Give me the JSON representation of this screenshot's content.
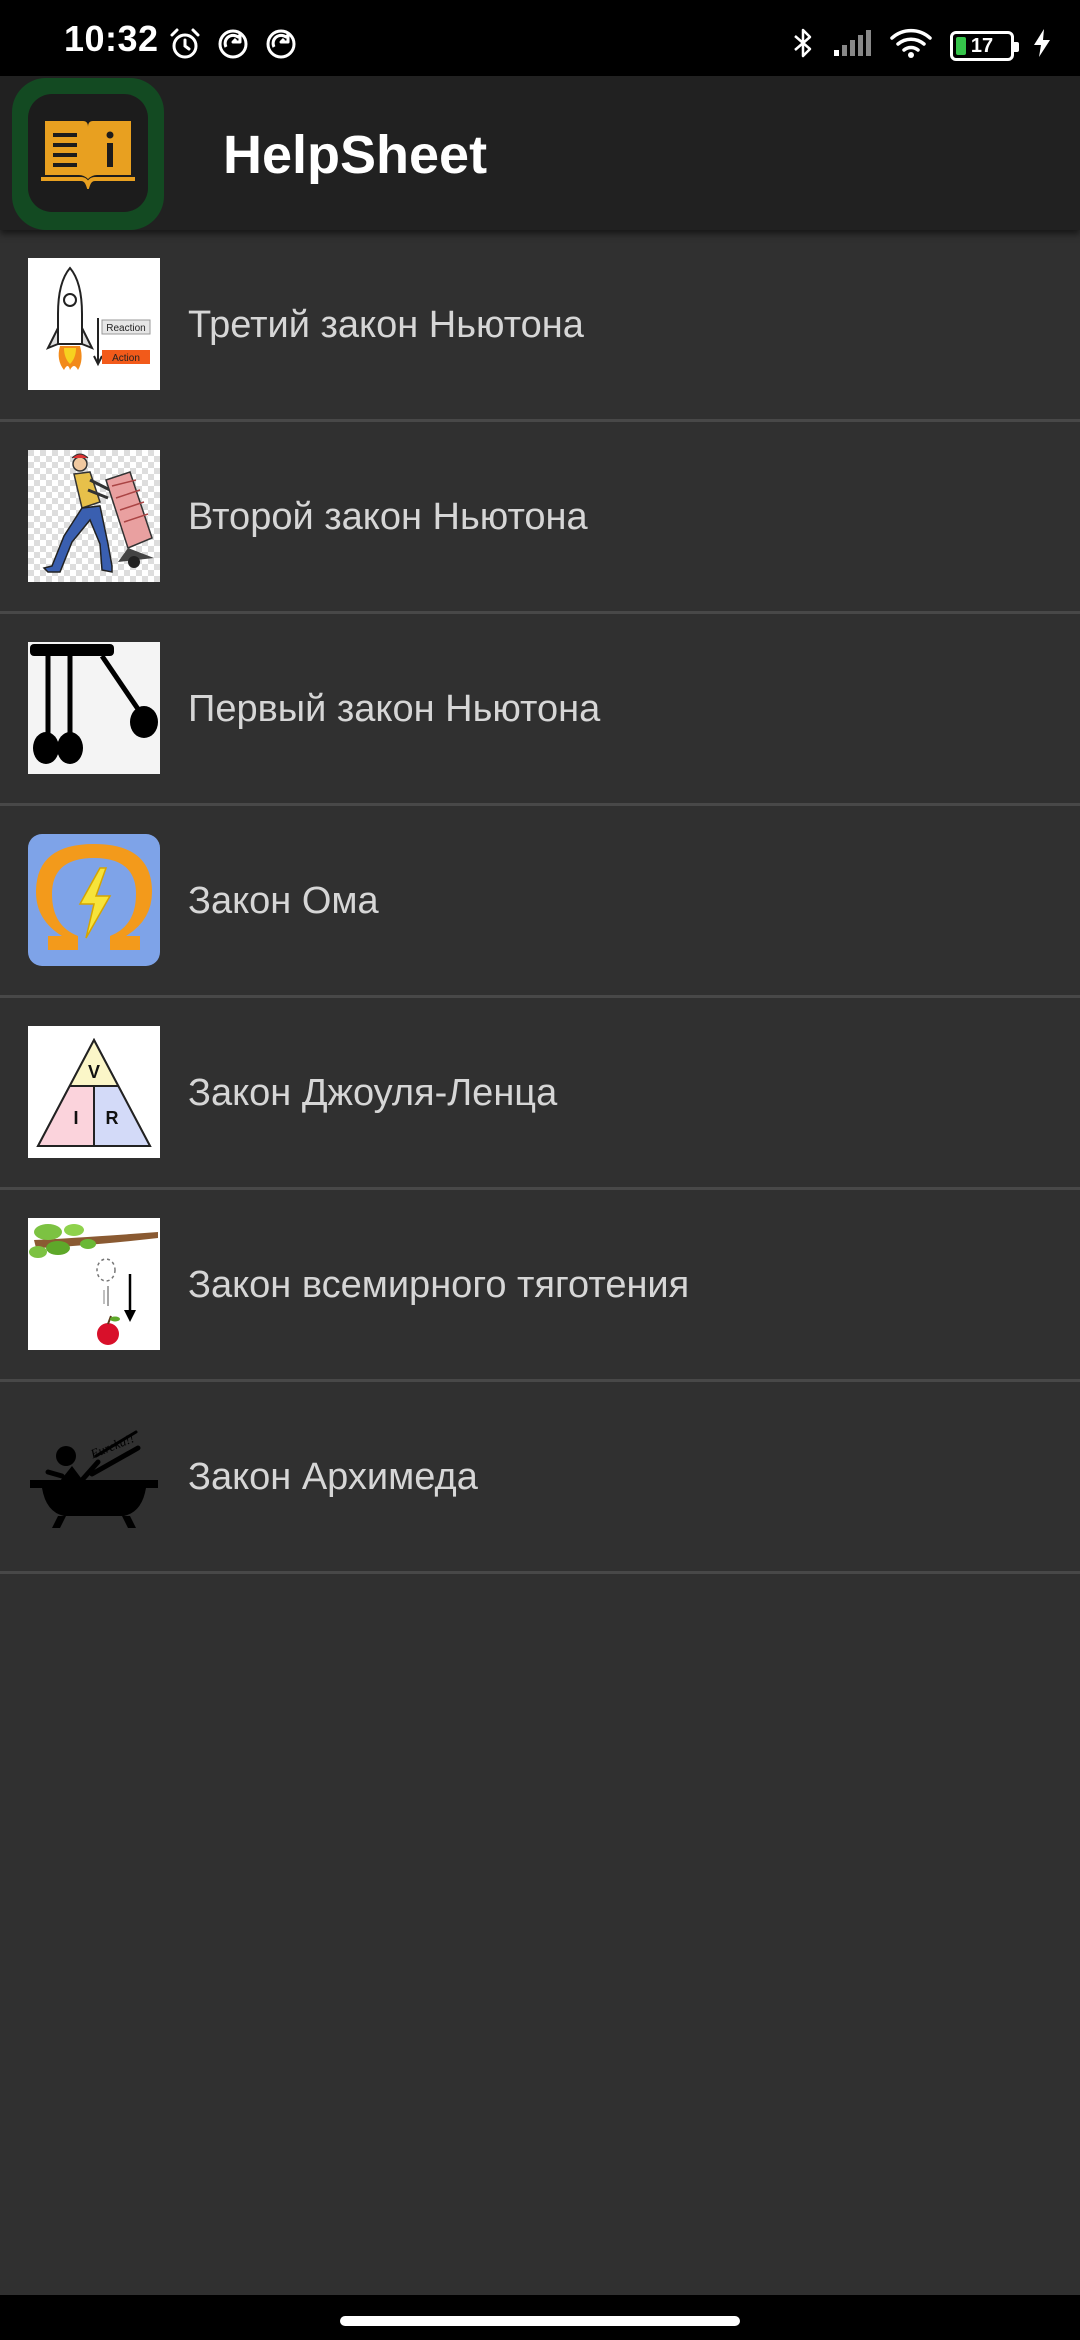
{
  "status_bar": {
    "time": "10:32",
    "battery_level": "17",
    "left_icons": [
      "alarm-icon",
      "sync-icon",
      "sync-icon"
    ],
    "right_icons": [
      "bluetooth-icon",
      "signal-icon",
      "wifi-icon",
      "battery-icon",
      "charging-icon"
    ]
  },
  "app_bar": {
    "title": "HelpSheet",
    "logo_icon": "book-info-icon"
  },
  "laws": [
    {
      "label": "Третий закон Ньютона",
      "icon": "rocket-reaction-action-icon"
    },
    {
      "label": "Второй закон Ньютона",
      "icon": "man-pushing-cart-icon"
    },
    {
      "label": "Первый закон Ньютона",
      "icon": "newtons-cradle-icon"
    },
    {
      "label": "Закон Ома",
      "icon": "omega-lightning-icon"
    },
    {
      "label": "Закон Джоуля-Ленца",
      "icon": "vir-triangle-icon"
    },
    {
      "label": "Закон всемирного тяготения",
      "icon": "falling-apple-icon"
    },
    {
      "label": "Закон Архимеда",
      "icon": "eureka-bathtub-icon"
    }
  ],
  "thumb_text": {
    "reaction": "Reaction",
    "action": "Action",
    "v": "V",
    "i": "I",
    "r": "R",
    "eureka": "Eureka!!"
  },
  "colors": {
    "background": "#303030",
    "app_bar": "#212121",
    "logo_green": "#134a22",
    "logo_orange": "#e8a020",
    "divider": "#484848",
    "text": "#d6d6d6",
    "battery_green": "#35c44a"
  }
}
